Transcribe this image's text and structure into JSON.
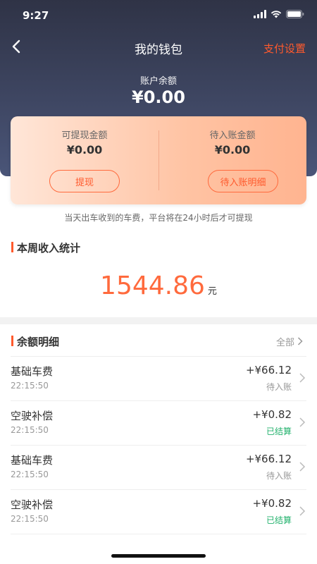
{
  "status_bar": {
    "time": "9:27"
  },
  "nav": {
    "title": "我的钱包",
    "pay_settings": "支付设置"
  },
  "balance": {
    "label": "账户余额",
    "value": "¥0.00"
  },
  "card": {
    "withdrawable": {
      "label": "可提现金额",
      "value": "¥0.00",
      "button": "提现"
    },
    "pending": {
      "label": "待入账金额",
      "value": "¥0.00",
      "button": "待入账明细"
    }
  },
  "notice": "当天出车收到的车费，平台将在24小时后才可提现",
  "weekly": {
    "title": "本周收入统计",
    "value": "1544.86",
    "unit": "元"
  },
  "detail": {
    "title": "余额明细",
    "view_all": "全部",
    "items": [
      {
        "name": "基础车费",
        "time": "22:15:50",
        "amount": "+¥66.12",
        "status": "待入账",
        "status_type": "pending"
      },
      {
        "name": "空驶补偿",
        "time": "22:15:50",
        "amount": "+¥0.82",
        "status": "已结算",
        "status_type": "settled"
      },
      {
        "name": "基础车费",
        "time": "22:15:50",
        "amount": "+¥66.12",
        "status": "待入账",
        "status_type": "pending"
      },
      {
        "name": "空驶补偿",
        "time": "22:15:50",
        "amount": "+¥0.82",
        "status": "已结算",
        "status_type": "settled"
      }
    ]
  },
  "colors": {
    "accent": "#ff5a2d",
    "settled": "#23b26d",
    "header_top": "#2f3346",
    "header_bottom": "#4a5578"
  }
}
